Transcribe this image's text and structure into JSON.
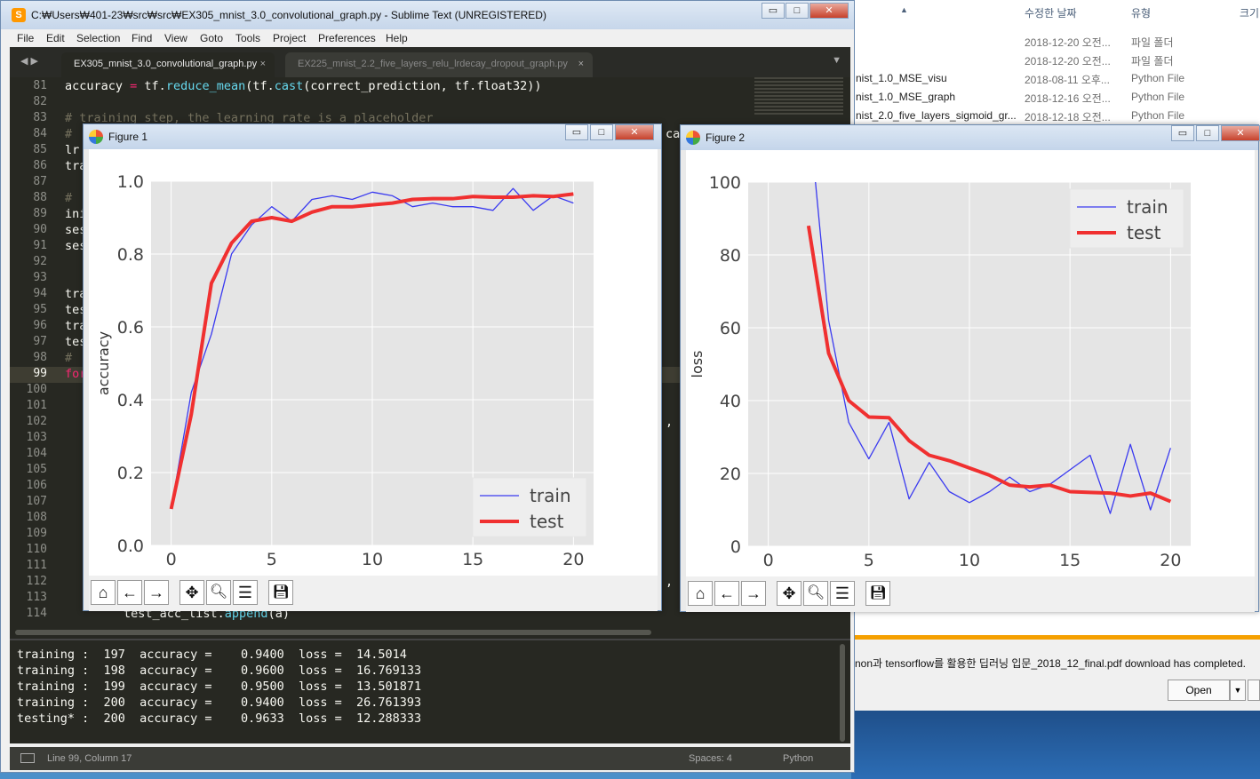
{
  "explorer": {
    "sort_arrow": "▲",
    "headers": {
      "date": "수정한 날짜",
      "type": "유형",
      "size": "크기"
    },
    "rows": [
      {
        "name": "",
        "date": "2018-12-20 오전...",
        "type": "파일 폴더"
      },
      {
        "name": "",
        "date": "2018-12-20 오전...",
        "type": "파일 폴더"
      },
      {
        "name": "nist_1.0_MSE_visu",
        "date": "2018-08-11 오후...",
        "type": "Python File"
      },
      {
        "name": "nist_1.0_MSE_graph",
        "date": "2018-12-16 오전...",
        "type": "Python File"
      },
      {
        "name": "nist_2.0_five_layers_sigmoid_gr...",
        "date": "2018-12-18 오전...",
        "type": "Python File"
      }
    ]
  },
  "download": {
    "message": "non과 tensorflow를 활용한 딥러닝 입문_2018_12_final.pdf download has completed.",
    "open_label": "Open",
    "arrow": "▼"
  },
  "sublime": {
    "title": "C:₩Users₩401-23₩src₩src₩EX305_mnist_3.0_convolutional_graph.py - Sublime Text (UNREGISTERED)",
    "window_buttons": {
      "min": "▭",
      "max": "□",
      "close": "✕"
    },
    "menu": [
      "File",
      "Edit",
      "Selection",
      "Find",
      "View",
      "Goto",
      "Tools",
      "Project",
      "Preferences",
      "Help"
    ],
    "nav": "◀ ▶",
    "tabs": [
      {
        "label": "EX305_mnist_3.0_convolutional_graph.py",
        "close": "×"
      },
      {
        "label": "EX225_mnist_2.2_five_layers_relu_lrdecay_dropout_graph.py",
        "close": "×"
      }
    ],
    "tab_menu": "▼",
    "line_numbers": [
      "81",
      "82",
      "83",
      "84",
      "85",
      "86",
      "87",
      "88",
      "89",
      "90",
      "91",
      "92",
      "93",
      "94",
      "95",
      "96",
      "97",
      "98",
      "99",
      "100",
      "101",
      "102",
      "103",
      "104",
      "105",
      "106",
      "107",
      "108",
      "109",
      "110",
      "111",
      "112",
      "113",
      "114"
    ],
    "code": {
      "l81_a": "accuracy ",
      "l81_eq": "=",
      "l81_b": " tf.",
      "l81_fn1": "reduce_mean",
      "l81_c": "(tf.",
      "l81_fn2": "cast",
      "l81_d": "(correct_prediction, tf.float32))",
      "l83": "# training step, the learning rate is a placeholder",
      "l84": "#",
      "l85": "lr",
      "l86": "tra",
      "l88": "# ",
      "l89": "ini",
      "l90": "ses",
      "l91": "ses",
      "l94": "tra",
      "l95": "tes",
      "l96": "tra",
      "l97": "tes",
      "l98": "# ",
      "l99": "for",
      "l104_tail": ",",
      "l112_tail": ",",
      "l114_a": "test_acc_list.",
      "l114_fn": "append",
      "l114_b": "(a)",
      "l84_tail": "ca"
    },
    "console_lines": [
      "training :  197  accuracy =    0.9400  loss =  14.5014",
      "training :  198  accuracy =    0.9600  loss =  16.769133",
      "training :  199  accuracy =    0.9500  loss =  13.501871",
      "training :  200  accuracy =    0.9400  loss =  26.761393",
      "testing* :  200  accuracy =    0.9633  loss =  12.288333"
    ],
    "status": {
      "position": "Line 99, Column 17",
      "spaces": "Spaces: 4",
      "syntax": "Python"
    }
  },
  "figures": {
    "fig1_title": "Figure 1",
    "fig2_title": "Figure 2",
    "toolbar_icons": [
      "home-icon",
      "back-icon",
      "forward-icon",
      "pan-icon",
      "zoom-icon",
      "configure-icon",
      "save-icon"
    ]
  },
  "chart_data": [
    {
      "type": "line",
      "ylabel": "accuracy",
      "xlim": [
        -1,
        21
      ],
      "ylim": [
        0.0,
        1.0
      ],
      "xticks": [
        0,
        5,
        10,
        15,
        20
      ],
      "yticks": [
        "0.0",
        "0.2",
        "0.4",
        "0.6",
        "0.8",
        "1.0"
      ],
      "x": [
        0,
        1,
        2,
        3,
        4,
        5,
        6,
        7,
        8,
        9,
        10,
        11,
        12,
        13,
        14,
        15,
        16,
        17,
        18,
        19,
        20
      ],
      "series": [
        {
          "name": "train",
          "color": "#3a3af0",
          "values": [
            0.1,
            0.42,
            0.58,
            0.8,
            0.88,
            0.93,
            0.89,
            0.95,
            0.96,
            0.95,
            0.97,
            0.96,
            0.93,
            0.94,
            0.93,
            0.93,
            0.92,
            0.98,
            0.92,
            0.96,
            0.94
          ]
        },
        {
          "name": "test",
          "color": "#f03030",
          "values": [
            0.1,
            0.36,
            0.72,
            0.83,
            0.89,
            0.9,
            0.89,
            0.915,
            0.93,
            0.93,
            0.935,
            0.94,
            0.95,
            0.952,
            0.952,
            0.958,
            0.956,
            0.956,
            0.96,
            0.958,
            0.965
          ]
        }
      ],
      "legend": "lower-right",
      "grid": true
    },
    {
      "type": "line",
      "ylabel": "loss",
      "xlim": [
        -1,
        21
      ],
      "ylim": [
        0,
        100
      ],
      "xticks": [
        0,
        5,
        10,
        15,
        20
      ],
      "yticks": [
        "0",
        "20",
        "40",
        "60",
        "80",
        "100"
      ],
      "x": [
        2,
        3,
        4,
        5,
        6,
        7,
        8,
        9,
        10,
        11,
        12,
        13,
        14,
        15,
        16,
        17,
        18,
        19,
        20
      ],
      "series": [
        {
          "name": "train",
          "color": "#3a3af0",
          "values": [
            120,
            62,
            34,
            24,
            34,
            13,
            23,
            15,
            12,
            15,
            19,
            15,
            17,
            21,
            25,
            9,
            28,
            10,
            27
          ]
        },
        {
          "name": "test",
          "color": "#f03030",
          "values": [
            88,
            53,
            40,
            35.5,
            35.3,
            29,
            25,
            23.5,
            21.5,
            19.5,
            16.8,
            16.3,
            16.8,
            15,
            14.8,
            14.6,
            13.8,
            14.6,
            12.3
          ]
        }
      ],
      "legend": "upper-right",
      "grid": true
    }
  ]
}
